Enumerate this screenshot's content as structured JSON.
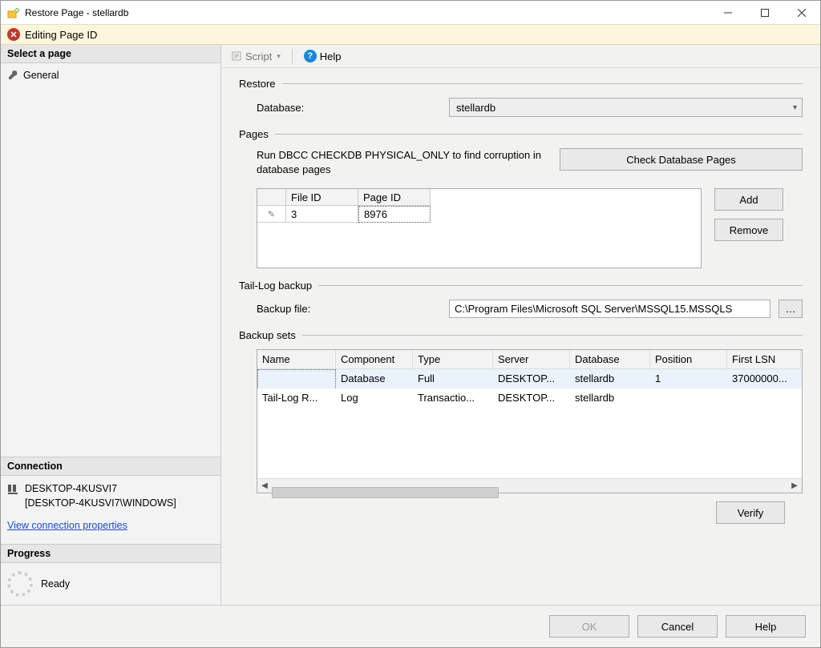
{
  "window": {
    "title": "Restore Page - stellardb"
  },
  "banner": {
    "text": "Editing Page ID"
  },
  "sidebar": {
    "select_page_header": "Select a page",
    "general_item": "General",
    "connection_header": "Connection",
    "server_line1": "DESKTOP-4KUSVI7",
    "server_line2": "[DESKTOP-4KUSVI7\\WINDOWS]",
    "view_props_link": "View connection properties",
    "progress_header": "Progress",
    "progress_text": "Ready"
  },
  "toolbar": {
    "script_label": "Script",
    "help_label": "Help"
  },
  "restore": {
    "group_title": "Restore",
    "db_label": "Database:",
    "db_value": "stellardb"
  },
  "pages": {
    "group_title": "Pages",
    "hint": "Run DBCC CHECKDB PHYSICAL_ONLY to find corruption in database pages",
    "check_btn": "Check Database Pages",
    "add_btn": "Add",
    "remove_btn": "Remove",
    "cols": {
      "file": "File ID",
      "page": "Page ID"
    },
    "rows": [
      {
        "file": "3",
        "page": "8976"
      }
    ]
  },
  "taillog": {
    "group_title": "Tail-Log backup",
    "label": "Backup file:",
    "value": "C:\\Program Files\\Microsoft SQL Server\\MSSQL15.MSSQLS"
  },
  "backupsets": {
    "group_title": "Backup sets",
    "cols": {
      "name": "Name",
      "component": "Component",
      "type": "Type",
      "server": "Server",
      "database": "Database",
      "position": "Position",
      "first_lsn": "First LSN"
    },
    "rows": [
      {
        "name": "",
        "component": "Database",
        "type": "Full",
        "server": "DESKTOP...",
        "database": "stellardb",
        "position": "1",
        "first_lsn": "37000000..."
      },
      {
        "name": "Tail-Log R...",
        "component": "Log",
        "type": "Transactio...",
        "server": "DESKTOP...",
        "database": "stellardb",
        "position": "",
        "first_lsn": ""
      }
    ],
    "verify_btn": "Verify"
  },
  "footer": {
    "ok": "OK",
    "cancel": "Cancel",
    "help": "Help"
  }
}
